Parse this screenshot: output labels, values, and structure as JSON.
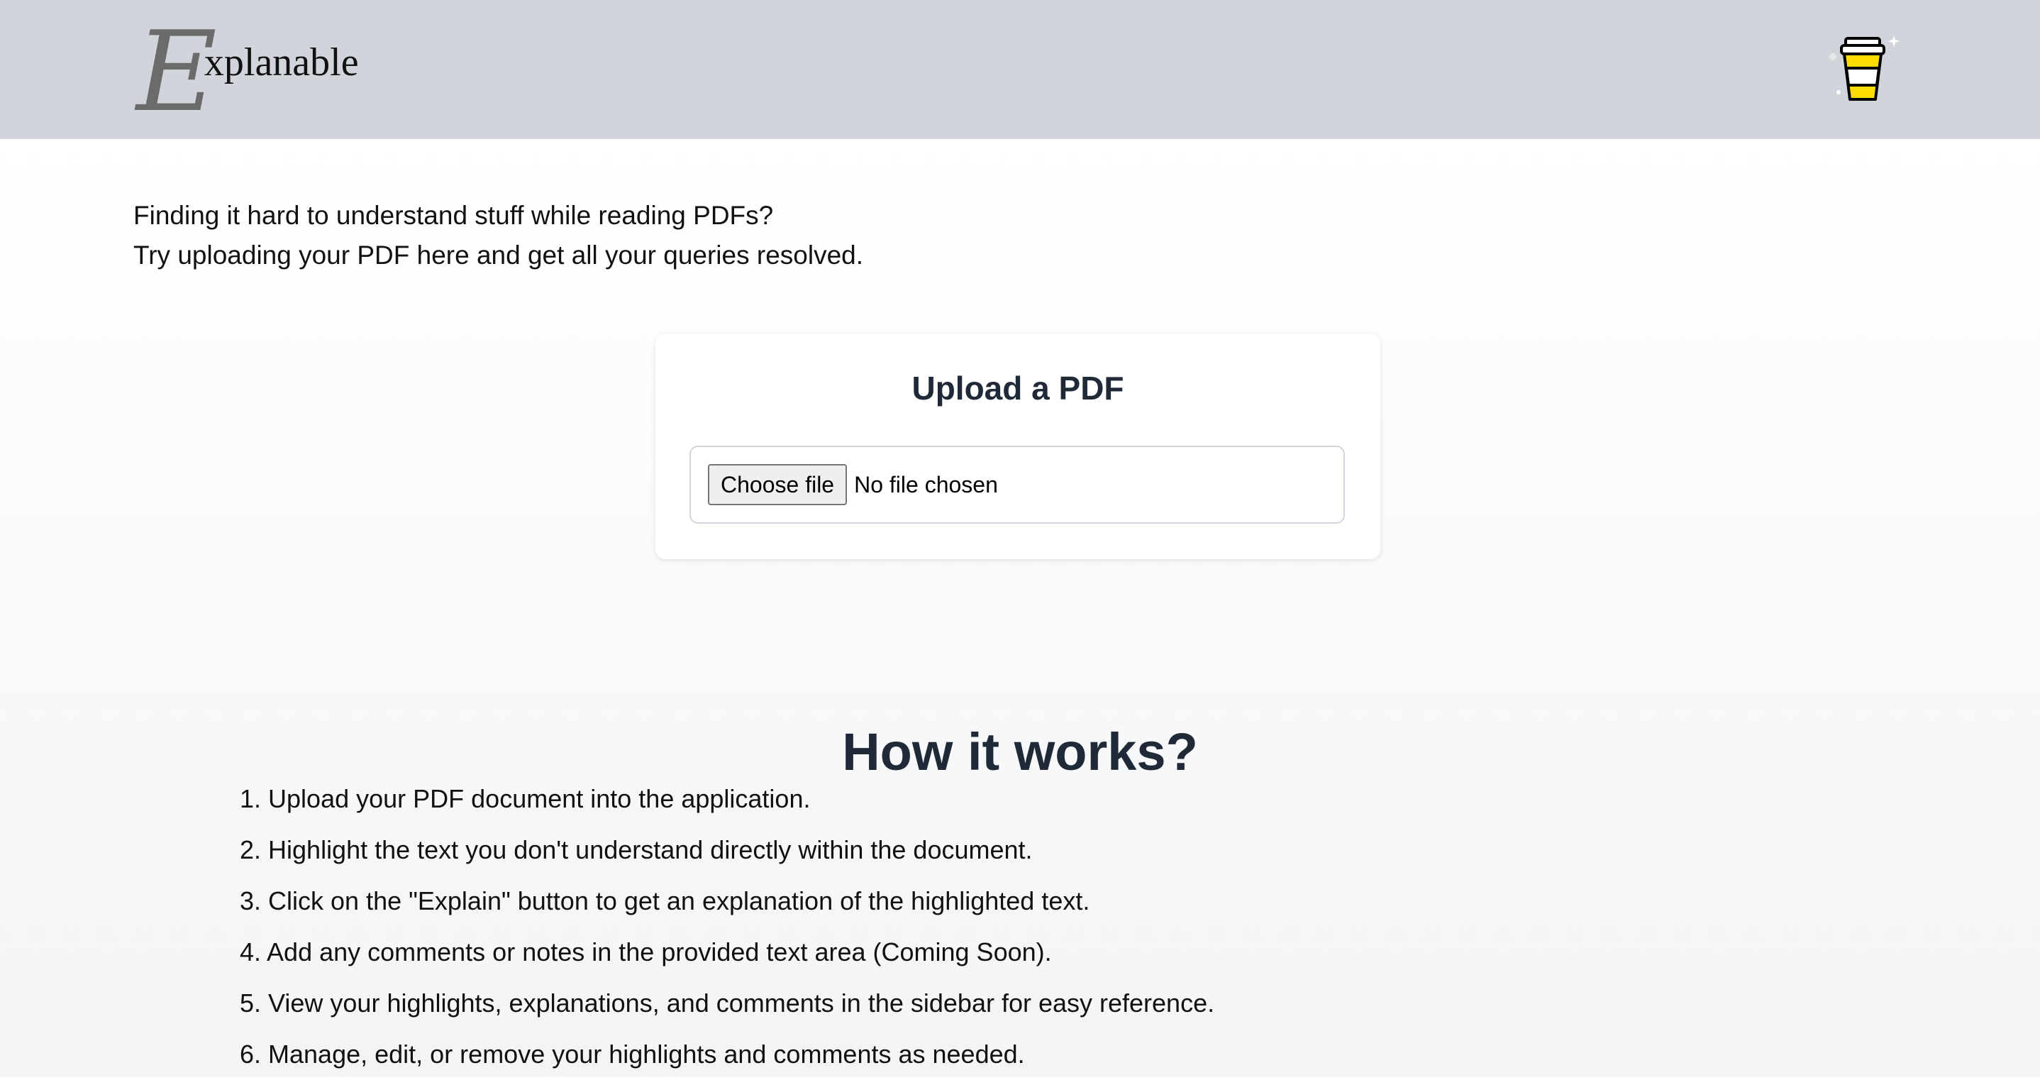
{
  "header": {
    "logo_initial": "E",
    "logo_rest": "xplanable",
    "coffee_icon": "buy-me-a-coffee-icon"
  },
  "intro": {
    "line1": "Finding it hard to understand stuff while reading PDFs?",
    "line2": "Try uploading your PDF here and get all your queries resolved."
  },
  "upload": {
    "title": "Upload a PDF",
    "button_label": "Choose file",
    "status": "No file chosen"
  },
  "how": {
    "title": "How it works?",
    "steps": [
      "1. Upload your PDF document into the application.",
      "2. Highlight the text you don't understand directly within the document.",
      "3. Click on the \"Explain\" button to get an explanation of the highlighted text.",
      "4. Add any comments or notes in the provided text area (Coming Soon).",
      "5. View your highlights, explanations, and comments in the sidebar for easy reference.",
      "6. Manage, edit, or remove your highlights and comments as needed."
    ]
  },
  "colors": {
    "header_bg": "#d1d5db",
    "heading": "#1f2937",
    "logo_e": "#6b6b6b",
    "coffee_yellow": "#ffdd00"
  }
}
